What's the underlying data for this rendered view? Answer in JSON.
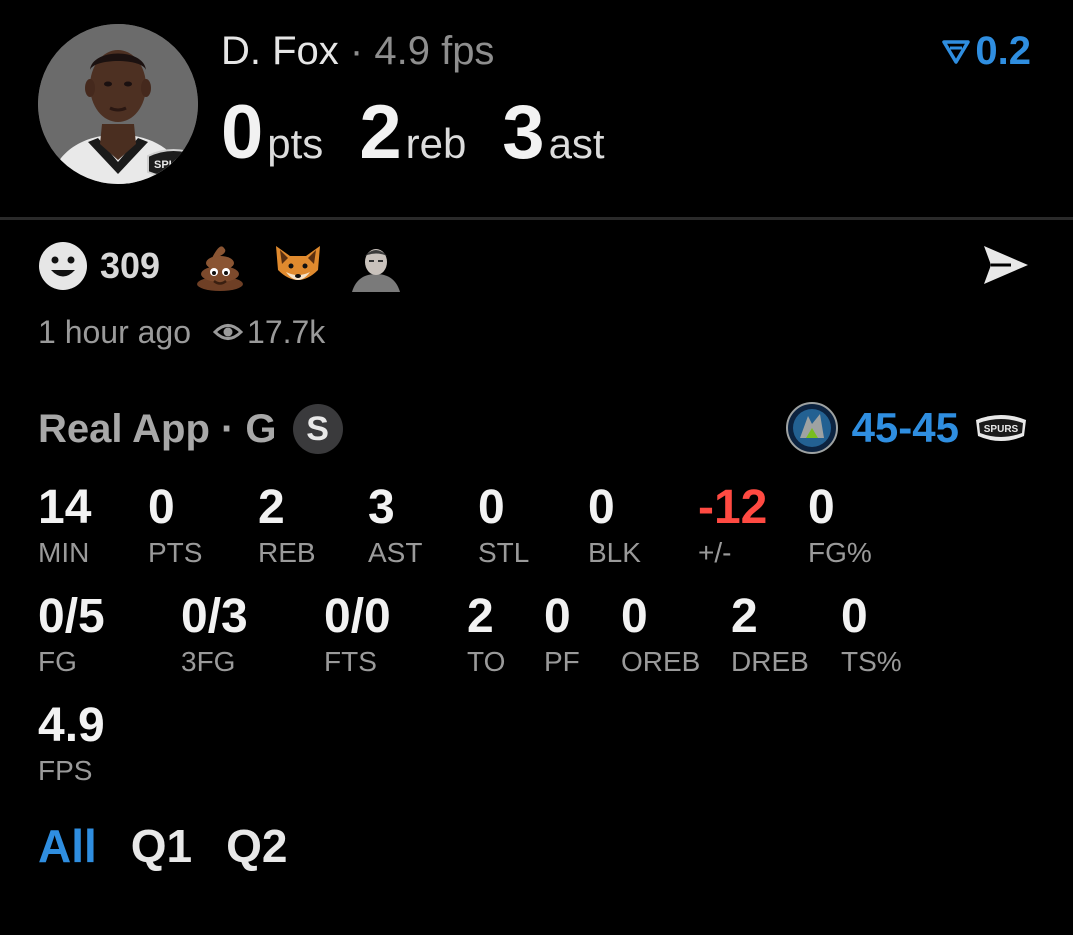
{
  "header": {
    "player_name": "D. Fox",
    "fps_label": "· 4.9 fps",
    "trend_value": "0.2",
    "trend_color": "#2f8ee0",
    "big_stats": [
      {
        "value": "0",
        "unit": "pts"
      },
      {
        "value": "2",
        "unit": "reb"
      },
      {
        "value": "3",
        "unit": "ast"
      }
    ],
    "avatar_icon": "player-photo",
    "team_badge": "SPURS"
  },
  "reactions": {
    "count": "309",
    "emojis": [
      "poop-emoji",
      "fox-emoji",
      "user-avatar"
    ],
    "time_ago": "1 hour ago",
    "views": "17.7k"
  },
  "game": {
    "label": "Real App · G",
    "badge": "S",
    "score": "45-45",
    "home_logo": "timberwolves-logo",
    "away_logo": "spurs-logo",
    "away_logo_text": "SPURS"
  },
  "stats_row1": [
    {
      "value": "14",
      "label": "MIN"
    },
    {
      "value": "0",
      "label": "PTS"
    },
    {
      "value": "2",
      "label": "REB"
    },
    {
      "value": "3",
      "label": "AST"
    },
    {
      "value": "0",
      "label": "STL"
    },
    {
      "value": "0",
      "label": "BLK"
    },
    {
      "value": "-12",
      "label": "+/-"
    },
    {
      "value": "0",
      "label": "FG%"
    }
  ],
  "stats_row2": [
    {
      "value": "0/5",
      "label": "FG"
    },
    {
      "value": "0/3",
      "label": "3FG"
    },
    {
      "value": "0/0",
      "label": "FTS"
    },
    {
      "value": "2",
      "label": "TO"
    },
    {
      "value": "0",
      "label": "PF"
    },
    {
      "value": "0",
      "label": "OREB"
    },
    {
      "value": "2",
      "label": "DREB"
    },
    {
      "value": "0",
      "label": "TS%"
    }
  ],
  "stats_row3": [
    {
      "value": "4.9",
      "label": "FPS"
    }
  ],
  "tabs": [
    {
      "label": "All",
      "active": true
    },
    {
      "label": "Q1",
      "active": false
    },
    {
      "label": "Q2",
      "active": false
    }
  ],
  "colors": {
    "accent": "#2f8ee0",
    "negative": "#ff4a42",
    "background": "#000000"
  }
}
